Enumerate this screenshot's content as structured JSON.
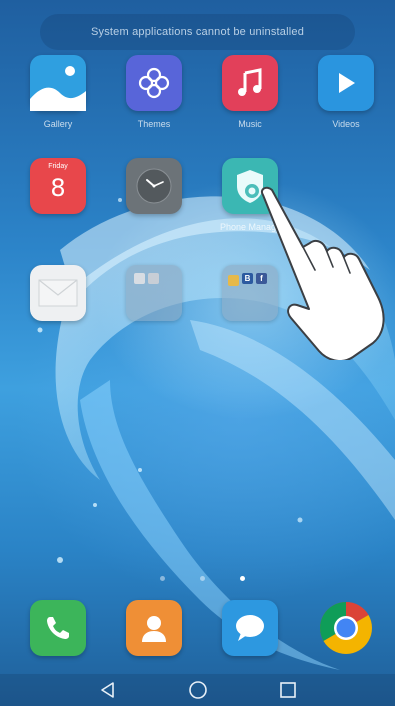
{
  "toast": {
    "text": "System applications cannot be uninstalled"
  },
  "apps": {
    "gallery": {
      "label": "Gallery"
    },
    "themes": {
      "label": "Themes"
    },
    "music": {
      "label": "Music"
    },
    "videos": {
      "label": "Videos"
    },
    "calendar": {
      "label": "",
      "day": "Friday",
      "date": "8"
    },
    "clock": {
      "label": ""
    },
    "phone_manager": {
      "label": "Phone Manager"
    },
    "email": {
      "label": ""
    },
    "folder1": {
      "label": ""
    },
    "folder2": {
      "label": "",
      "mini_letters": [
        "B",
        "f"
      ]
    }
  },
  "dock": [
    "Phone",
    "Contacts",
    "Messaging",
    "Chrome"
  ],
  "page_indicator": {
    "count": 3,
    "active_index": 2
  },
  "colors": {
    "gallery": "#2f9fe0",
    "themes": "#5865d9",
    "music": "#e2405a",
    "videos": "#2a95df",
    "calendar": "#e8474b",
    "clock": "#6c7378",
    "phone_manager": "#3bb7b3",
    "phone": "#3cb55a",
    "contacts": "#ef8f36",
    "messaging": "#2d98e0"
  }
}
